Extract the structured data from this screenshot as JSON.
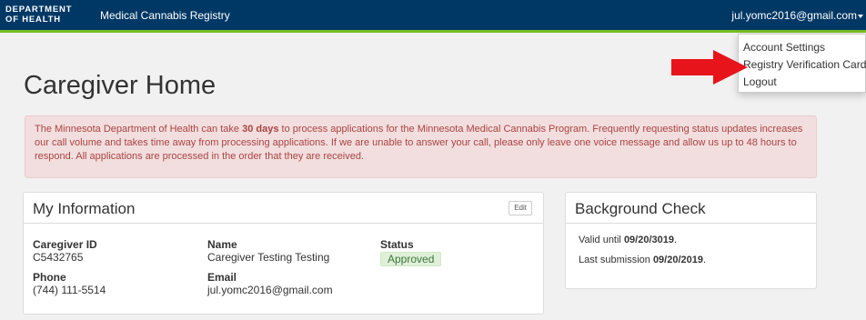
{
  "nav": {
    "logo_line1": "DEPARTMENT",
    "logo_line2": "OF HEALTH",
    "app_name": "Medical Cannabis Registry",
    "user_email": "jul.yomc2016@gmail.com"
  },
  "dropdown": {
    "items": [
      "Account Settings",
      "Registry Verification Card",
      "Logout"
    ]
  },
  "page": {
    "title": "Caregiver Home"
  },
  "alert": {
    "part1": "The Minnesota Department of Health can take ",
    "bold": "30 days",
    "part2": " to process applications for the Minnesota Medical Cannabis Program. Frequently requesting status updates increases our call volume and takes time away from processing applications. If we are unable to answer your call, please only leave one voice message and allow us up to 48 hours to respond. All applications are processed in the order that they are received."
  },
  "my_info": {
    "title": "My Information",
    "edit_label": "Edit",
    "caregiver_id_label": "Caregiver ID",
    "caregiver_id": "C5432765",
    "name_label": "Name",
    "name": "Caregiver Testing Testing",
    "status_label": "Status",
    "status": "Approved",
    "phone_label": "Phone",
    "phone": "(744) 111-5514",
    "email_label": "Email",
    "email": "jul.yomc2016@gmail.com"
  },
  "background": {
    "title": "Background Check",
    "valid_prefix": "Valid until ",
    "valid_date": "09/20/3019",
    "valid_suffix": ".",
    "last_prefix": "Last submission ",
    "last_date": "09/20/2019",
    "last_suffix": "."
  },
  "colors": {
    "nav_bg": "#003865",
    "nav_accent": "#78be21",
    "alert_bg": "#f2dede",
    "alert_text": "#a94442",
    "badge_bg": "#dff0d8",
    "badge_text": "#3c763d",
    "annotation_arrow": "#e8141c"
  }
}
